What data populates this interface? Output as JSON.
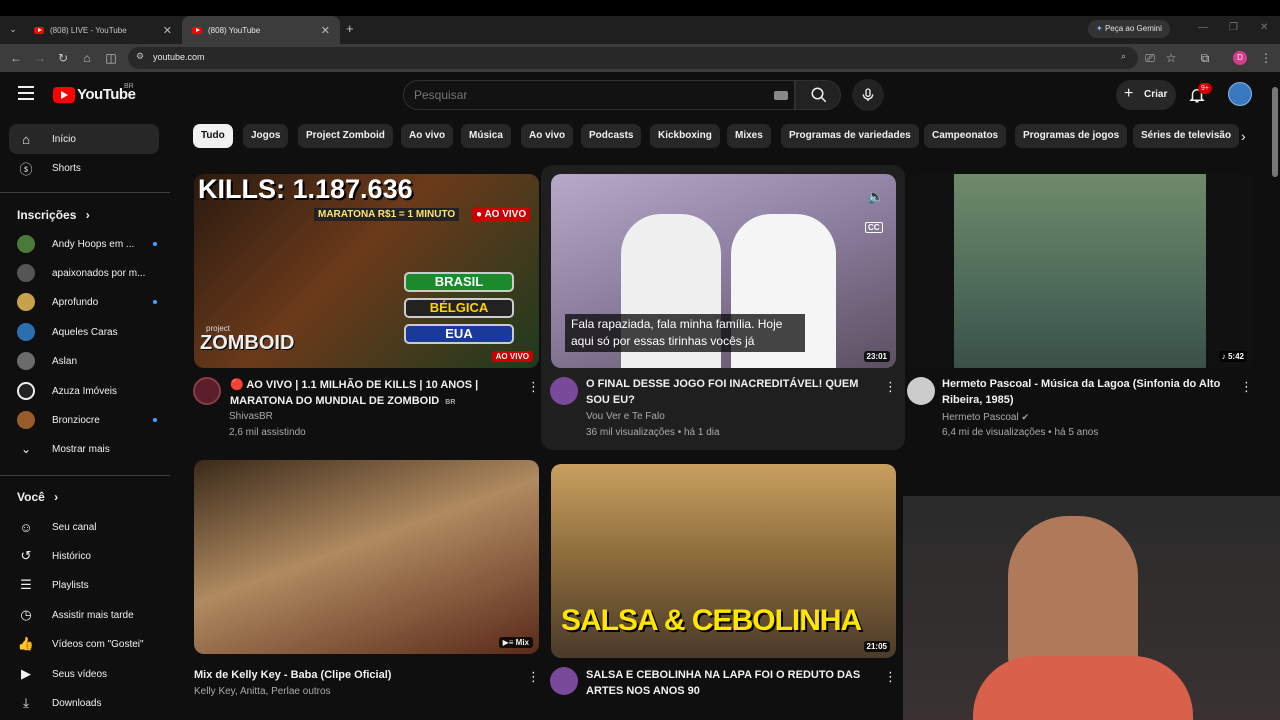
{
  "browser": {
    "tabs": [
      {
        "title": "(808) LIVE - YouTube"
      },
      {
        "title": "(808) YouTube"
      }
    ],
    "new_tab": "+",
    "close": "✕",
    "gemini_label": "Peça ao Gemini",
    "profile_initial": "D",
    "url": "youtube.com"
  },
  "masthead": {
    "logo_text": "YouTube",
    "region": "BR",
    "search_placeholder": "Pesquisar",
    "create_label": "Criar",
    "notif_badge": "9+"
  },
  "sidebar": {
    "main": [
      {
        "label": "Início",
        "icon": "home-icon"
      },
      {
        "label": "Shorts",
        "icon": "shorts-icon"
      }
    ],
    "subs_title": "Inscrições",
    "subs": [
      {
        "label": "Andy Hoops em ...",
        "dot": true,
        "color": "#4a7a3a"
      },
      {
        "label": "apaixonados por m...",
        "dot": false,
        "color": "#555555"
      },
      {
        "label": "Aprofundo",
        "dot": true,
        "color": "#c8a24a"
      },
      {
        "label": "Aqueles Caras",
        "dot": false,
        "color": "#2a6fb0"
      },
      {
        "label": "Aslan",
        "dot": false,
        "color": "#6b6b6b"
      },
      {
        "label": "Azuza Imóveis",
        "dot": false,
        "color": "#222222"
      },
      {
        "label": "Bronziocre",
        "dot": true,
        "color": "#9a5b2a"
      }
    ],
    "show_more": "Mostrar mais",
    "you_title": "Você",
    "you": [
      {
        "label": "Seu canal",
        "icon": "channel-icon"
      },
      {
        "label": "Histórico",
        "icon": "history-icon"
      },
      {
        "label": "Playlists",
        "icon": "playlists-icon"
      },
      {
        "label": "Assistir mais tarde",
        "icon": "watch-later-icon"
      },
      {
        "label": "Vídeos com \"Gostei\"",
        "icon": "like-icon"
      },
      {
        "label": "Seus vídeos",
        "icon": "your-videos-icon"
      },
      {
        "label": "Downloads",
        "icon": "download-icon"
      }
    ]
  },
  "chips": [
    "Tudo",
    "Jogos",
    "Project Zomboid",
    "Ao vivo",
    "Música",
    "Ao vivo",
    "Podcasts",
    "Kickboxing",
    "Mixes",
    "Programas de variedades",
    "Campeonatos",
    "Programas de jogos",
    "Séries de televisão"
  ],
  "videos": [
    {
      "title": "🔴 AO VIVO | 1.1 MILHÃO DE KILLS | 10 ANOS | MARATONA DO MUNDIAL DE ZOMBOID",
      "title_suffix": "BR",
      "channel": "ShivasBR",
      "meta": "2,6 mil assistindo",
      "thumb_kills": "KILLS: 1.187.636",
      "thumb_maratona": "MARATONA R$1 = 1 MINUTO",
      "thumb_live": "● AO VIVO",
      "thumb_flags": [
        "BRASIL",
        "BÉLGICA",
        "EUA"
      ],
      "thumb_brand": "ZOMBOID",
      "thumb_brand_small": "project",
      "badge": "AO VIVO"
    },
    {
      "title": "O FINAL DESSE JOGO FOI INACREDITÁVEL! QUEM SOU EU?",
      "channel": "Vou Ver e Te Falo",
      "meta": "36 mil visualizações • há 1 dia",
      "caption": "Fala rapaziada, fala minha família. Hoje aqui só por essas tirinhas vocês já",
      "duration": "23:01",
      "cc": "CC"
    },
    {
      "title": "Hermeto Pascoal - Música da Lagoa (Sinfonia do Alto Ribeira, 1985)",
      "channel": "Hermeto Pascoal",
      "meta": "6,4 mi de visualizações • há 5 anos",
      "duration": "5:42"
    },
    {
      "title": "Mix de Kelly Key - Baba (Clipe Oficial)",
      "channel": "Kelly Key, Anitta, Perlae outros",
      "badge": "Mix"
    },
    {
      "title": "SALSA E CEBOLINHA NA LAPA FOI O REDUTO DAS ARTES NOS ANOS 90",
      "duration": "21:05",
      "thumb_text": "SALSA & CEBOLINHA"
    }
  ]
}
